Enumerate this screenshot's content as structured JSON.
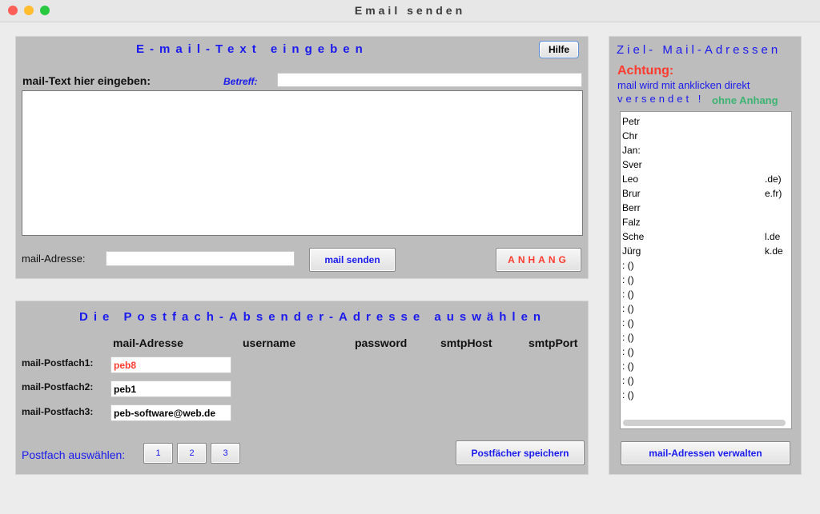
{
  "window": {
    "title": "Email senden"
  },
  "compose": {
    "title": "E-mail-Text eingeben",
    "help_label": "Hilfe",
    "text_label": "mail-Text hier eingeben:",
    "subject_label": "Betreff:",
    "subject_value": "",
    "body_value": "",
    "address_label": "mail-Adresse:",
    "address_value": "",
    "send_label": "mail senden",
    "attach_label": "ANHANG"
  },
  "mailbox": {
    "title": "Die Postfach-Absender-Adresse auswählen",
    "columns": [
      "mail-Adresse",
      "username",
      "password",
      "smtpHost",
      "smtpPort"
    ],
    "rows": [
      {
        "label": "mail-Postfach1:",
        "address": "peb8"
      },
      {
        "label": "mail-Postfach2:",
        "address": "peb1"
      },
      {
        "label": "mail-Postfach3:",
        "address": "peb-software@web.de"
      }
    ],
    "select_label": "Postfach auswählen:",
    "select_buttons": [
      "1",
      "2",
      "3"
    ],
    "save_label": "Postfächer speichern"
  },
  "targets": {
    "title": "Ziel- Mail-Adressen",
    "warning_title": "Achtung:",
    "warning_line1": "mail wird mit anklicken direkt",
    "warning_line2": "versendet !",
    "no_attachment": "ohne Anhang",
    "items": [
      {
        "left": "Petr",
        "right": ""
      },
      {
        "left": "Chr",
        "right": ""
      },
      {
        "left": "Jan:",
        "right": ""
      },
      {
        "left": "Sver",
        "right": ""
      },
      {
        "left": "Leo",
        "right": ".de)"
      },
      {
        "left": "Brur",
        "right": "e.fr)"
      },
      {
        "left": "Berr",
        "right": ""
      },
      {
        "left": "Falz",
        "right": ""
      },
      {
        "left": "Sche",
        "right": "l.de"
      },
      {
        "left": "Jürg",
        "right": "k.de"
      },
      {
        "left": ": ()",
        "right": ""
      },
      {
        "left": ": ()",
        "right": ""
      },
      {
        "left": ": ()",
        "right": ""
      },
      {
        "left": ": ()",
        "right": ""
      },
      {
        "left": ": ()",
        "right": ""
      },
      {
        "left": ": ()",
        "right": ""
      },
      {
        "left": ": ()",
        "right": ""
      },
      {
        "left": ": ()",
        "right": ""
      },
      {
        "left": ": ()",
        "right": ""
      },
      {
        "left": ": ()",
        "right": ""
      }
    ],
    "manage_label": "mail-Adressen verwalten"
  },
  "colors": {
    "accent_blue": "#1a1aee",
    "warning_red": "#ff3b30",
    "ok_green": "#3cb371",
    "panel_gray": "#bdbdbd"
  }
}
